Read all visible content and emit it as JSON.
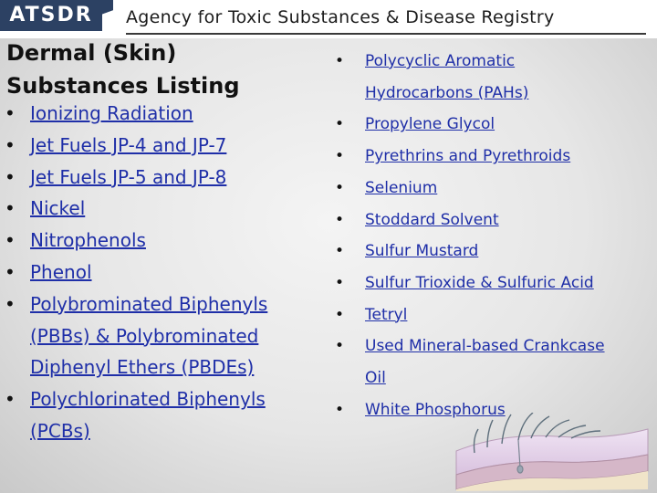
{
  "banner": {
    "logo_text": "ATSDR",
    "agency_name": "Agency for Toxic Substances & Disease Registry"
  },
  "slide": {
    "title_line1": "Dermal (Skin)",
    "title_line2": "Substances Listing"
  },
  "left_list": [
    [
      "Ionizing Radiation"
    ],
    [
      "Jet Fuels JP-4 and JP-7"
    ],
    [
      "Jet Fuels JP-5 and JP-8"
    ],
    [
      "Nickel"
    ],
    [
      "Nitrophenols"
    ],
    [
      "Phenol"
    ],
    [
      "Polybrominated Biphenyls",
      "(PBBs) & Polybrominated",
      "Diphenyl Ethers (PBDEs)"
    ],
    [
      "Polychlorinated Biphenyls",
      "(PCBs)"
    ]
  ],
  "right_list": [
    [
      "Polycyclic Aromatic",
      "Hydrocarbons (PAHs)"
    ],
    [
      "Propylene Glycol"
    ],
    [
      "Pyrethrins and Pyrethroids"
    ],
    [
      "Selenium"
    ],
    [
      "Stoddard Solvent"
    ],
    [
      "Sulfur Mustard"
    ],
    [
      "Sulfur Trioxide & Sulfuric Acid"
    ],
    [
      "Tetryl"
    ],
    [
      "Used Mineral-based Crankcase",
      "Oil"
    ],
    [
      "White Phosphorus"
    ]
  ],
  "colors": {
    "link": "#1f2fa8",
    "logo_bg": "#2c4163",
    "skin_surface": "#e7d7ef",
    "skin_layer": "#d5b7c8",
    "skin_base": "#f0e4c9"
  },
  "illustration": "skin-cross-section-with-hair"
}
